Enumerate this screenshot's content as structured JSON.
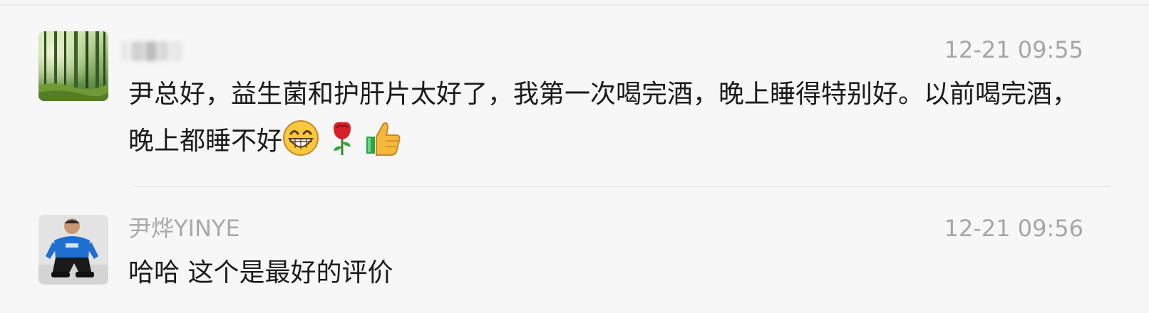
{
  "comments": [
    {
      "author": "",
      "author_blurred": true,
      "avatar": "forest-avatar",
      "time": "12-21 09:55",
      "text": "尹总好，益生菌和护肝片太好了，我第一次喝完酒，晚上睡得特别好。以前喝完酒，晚上都睡不好",
      "emojis": [
        "grinning-face-emoji",
        "rose-emoji",
        "thumbs-up-emoji"
      ]
    },
    {
      "author": "尹烨YINYE",
      "avatar": "person-avatar",
      "time": "12-21 09:56",
      "text": "哈哈 这个是最好的评价"
    }
  ],
  "colors": {
    "background": "#f7f7f7",
    "name": "#a9a9a9",
    "time": "#a6a6a6",
    "text": "#1a1a1a"
  }
}
